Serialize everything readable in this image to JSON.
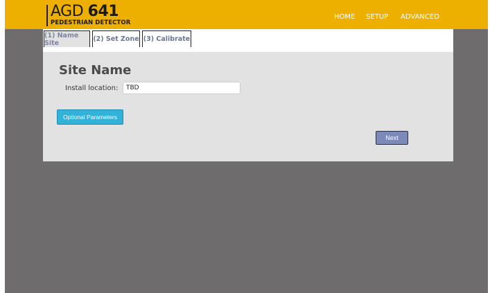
{
  "header": {
    "logo_light": "AGD ",
    "logo_bold": "641",
    "logo_subtitle": "PEDESTRIAN DETECTOR",
    "nav": [
      "HOME",
      "SETUP",
      "ADVANCED"
    ]
  },
  "tabs": [
    {
      "label": "(1) Name Site",
      "active": true
    },
    {
      "label": "(2) Set Zone",
      "active": false
    },
    {
      "label": "(3) Calibrate",
      "active": false
    }
  ],
  "form": {
    "title": "Site Name",
    "install_location_label": "Install location:",
    "install_location_value": "TBD"
  },
  "buttons": {
    "optional_parameters": "Optional Parameters",
    "next": "Next"
  },
  "colors": {
    "header_bg": "#eeb000",
    "page_bg": "#6e6c6c",
    "panel_bg": "#e2e2e2",
    "optional_button": "#32b2d9",
    "next_button": "#7b8ab9"
  }
}
